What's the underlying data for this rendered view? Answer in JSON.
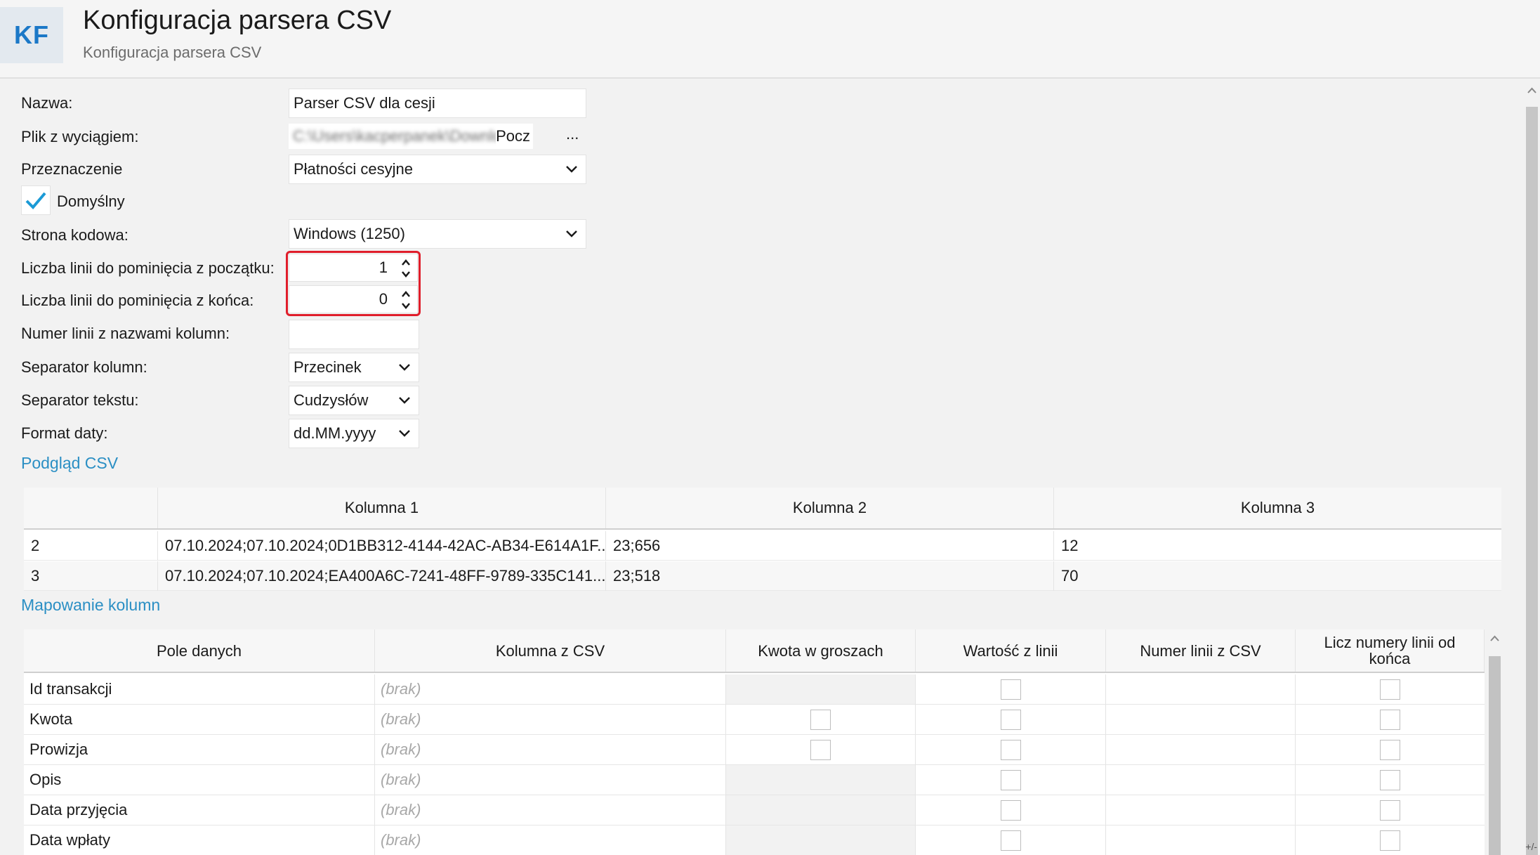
{
  "header": {
    "logo": "KF",
    "title": "Konfiguracja parsera CSV",
    "subtitle": "Konfiguracja parsera CSV"
  },
  "form": {
    "name_label": "Nazwa:",
    "name_value": "Parser CSV dla cesji",
    "file_label": "Plik z wyciągiem:",
    "file_value_blurred": "C:\\Users\\kacperpanek\\Downloads\\",
    "file_value_tail": "Pocz",
    "file_browse": "...",
    "purpose_label": "Przeznaczenie",
    "purpose_value": "Płatności cesyjne",
    "default_label": "Domyślny",
    "default_checked": true,
    "encoding_label": "Strona kodowa:",
    "encoding_value": "Windows (1250)",
    "skip_start_label": "Liczba linii do pominięcia z początku:",
    "skip_start_value": "1",
    "skip_end_label": "Liczba linii do pominięcia z końca:",
    "skip_end_value": "0",
    "header_line_label": "Numer linii z nazwami kolumn:",
    "header_line_value": "",
    "col_sep_label": "Separator kolumn:",
    "col_sep_value": "Przecinek",
    "text_sep_label": "Separator tekstu:",
    "text_sep_value": "Cudzysłów",
    "date_format_label": "Format daty:",
    "date_format_value": "dd.MM.yyyy"
  },
  "preview": {
    "section_label": "Podgląd CSV",
    "columns": [
      "",
      "Kolumna 1",
      "Kolumna 2",
      "Kolumna 3"
    ],
    "rows": [
      [
        "2",
        "07.10.2024;07.10.2024;0D1BB312-4144-42AC-AB34-E614A1F...",
        "23;656",
        "12"
      ],
      [
        "3",
        "07.10.2024;07.10.2024;EA400A6C-7241-48FF-9789-335C141...",
        "23;518",
        "70"
      ]
    ]
  },
  "mapping": {
    "section_label": "Mapowanie kolumn",
    "columns": [
      "Pole danych",
      "Kolumna z CSV",
      "Kwota w groszach",
      "Wartość z linii",
      "Numer linii z CSV",
      "Licz numery linii od końca"
    ],
    "placeholder": "(brak)",
    "rows": [
      {
        "field": "Id transakcji",
        "grosze": false
      },
      {
        "field": "Kwota",
        "grosze": true
      },
      {
        "field": "Prowizja",
        "grosze": true
      },
      {
        "field": "Opis",
        "grosze": false
      },
      {
        "field": "Data przyjęcia",
        "grosze": false
      },
      {
        "field": "Data wpłaty",
        "grosze": false
      }
    ]
  },
  "corner_mark": "+/-"
}
